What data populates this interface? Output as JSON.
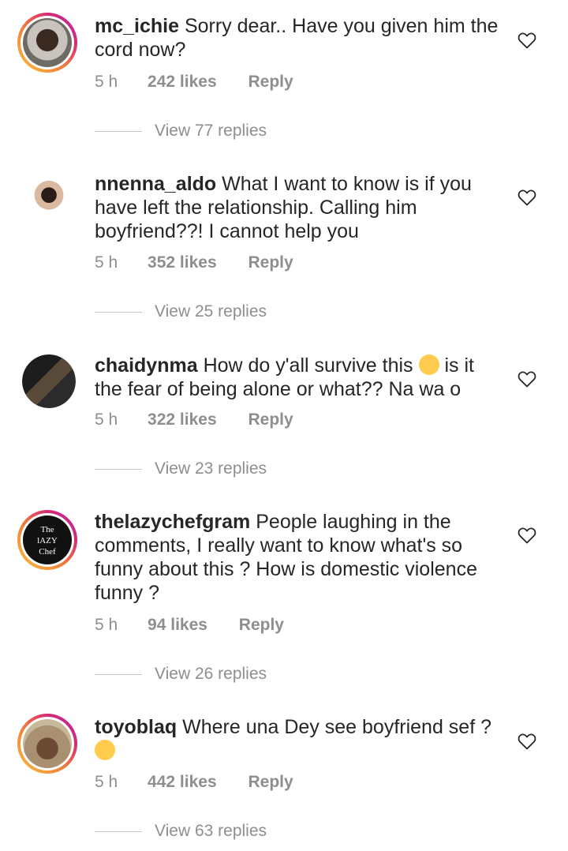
{
  "comments": [
    {
      "username": "mc_ichie",
      "text": "Sorry dear.. Have you given him the cord now?",
      "time": "5 h",
      "likes": "242 likes",
      "reply": "Reply",
      "view_replies": "View 77 replies"
    },
    {
      "username": "nnenna_aldo",
      "text": "What I want to know is if you have left the relationship. Calling him boyfriend??! I cannot help  you",
      "time": "5 h",
      "likes": "352 likes",
      "reply": "Reply",
      "view_replies": "View 25 replies"
    },
    {
      "username": "chaidynma",
      "text_before": "How do y'all survive this",
      "text_after": "is it the fear of being alone or what?? Na wa o",
      "emoji": "crying-face-emoji",
      "time": "5 h",
      "likes": "322 likes",
      "reply": "Reply",
      "view_replies": "View 23 replies"
    },
    {
      "username": "thelazychefgram",
      "text": "People laughing in the comments, I really want to know what's so funny about this ? How is domestic violence funny ?",
      "avatar_text": [
        "The",
        "lAZY",
        "Chef"
      ],
      "time": "5 h",
      "likes": "94 likes",
      "reply": "Reply",
      "view_replies": "View 26 replies"
    },
    {
      "username": "toyoblaq",
      "text": "Where una Dey see boyfriend sef ?",
      "emoji": "laughing-emoji",
      "time": "5 h",
      "likes": "442 likes",
      "reply": "Reply",
      "view_replies": "View 63 replies"
    }
  ],
  "colors": {
    "primary_text": "#262626",
    "secondary_text": "#8e8e8e",
    "story_ring": "#d62976"
  }
}
